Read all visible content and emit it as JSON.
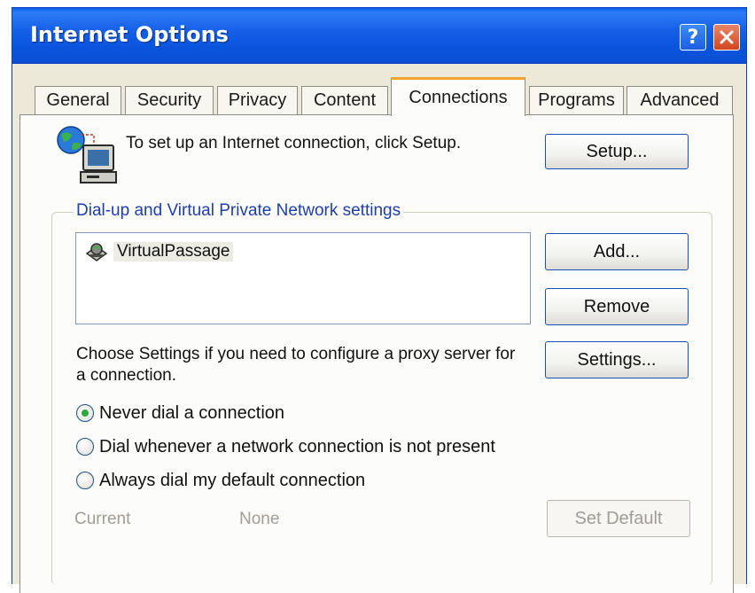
{
  "window": {
    "title": "Internet Options",
    "help_button": "?",
    "close_icon": "close-x-icon"
  },
  "tabs": [
    {
      "label": "General",
      "active": false
    },
    {
      "label": "Security",
      "active": false
    },
    {
      "label": "Privacy",
      "active": false
    },
    {
      "label": "Content",
      "active": false
    },
    {
      "label": "Connections",
      "active": true
    },
    {
      "label": "Programs",
      "active": false
    },
    {
      "label": "Advanced",
      "active": false
    }
  ],
  "setup": {
    "icon": "network-computer-icon",
    "text": "To set up an Internet connection, click Setup.",
    "button_label": "Setup..."
  },
  "dialup": {
    "legend": "Dial-up and Virtual Private Network settings",
    "connections": [
      {
        "name": "VirtualPassage",
        "icon": "vpn-connection-icon"
      }
    ],
    "add_label": "Add...",
    "remove_label": "Remove",
    "proxy_text": "Choose Settings if you need to configure a proxy server for a connection.",
    "settings_label": "Settings...",
    "options": [
      {
        "label": "Never dial a connection",
        "selected": true
      },
      {
        "label": "Dial whenever a network connection is not present",
        "selected": false
      },
      {
        "label": "Always dial my default connection",
        "selected": false
      }
    ],
    "current_label": "Current",
    "current_value": "None",
    "set_default_label": "Set Default"
  },
  "colors": {
    "titlebar": "#0a55de",
    "active_tab_accent": "#f3a52f",
    "button_border": "#1c4fb0",
    "legend_text": "#1f3fa8",
    "radio_selected": "#2fa83a"
  }
}
